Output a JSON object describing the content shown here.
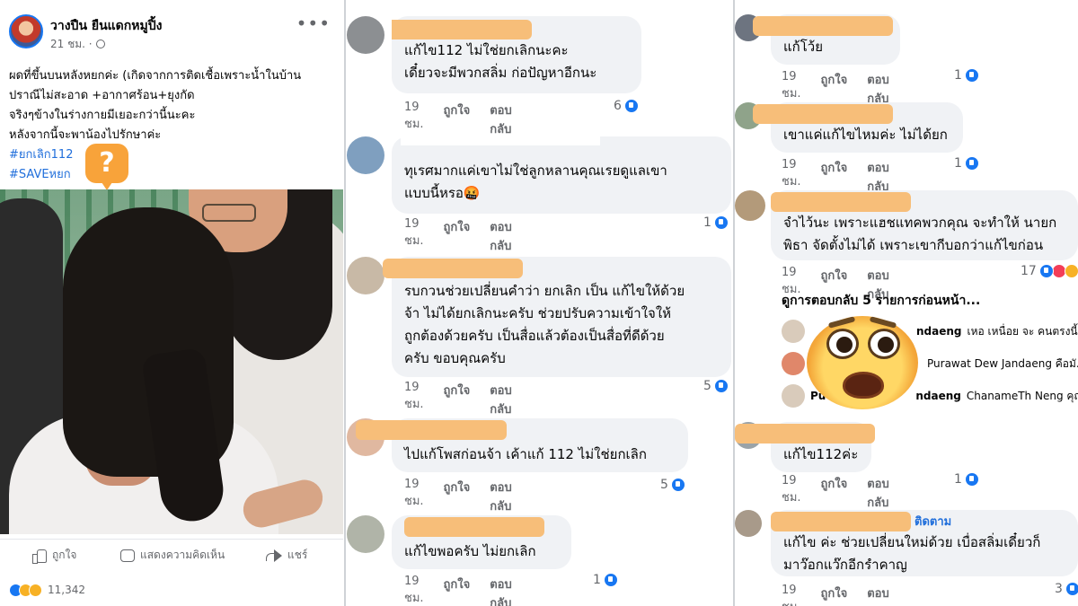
{
  "post": {
    "author": "วางปืน ยืนแดกหมูปิ้ง",
    "time": "21 ชม. ·",
    "text_lines": [
      "ผดที่ขึ้นบนหลังหยกค่ะ (เกิดจากการติดเชื้อเพราะน้ำในบ้าน",
      "ปราณีไม่สะอาด +อากาศร้อน+ยุงกัด",
      "จริงๆข้างในร่างกายมีเยอะกว่านี้นะคะ",
      "หลังจากนี้จะพาน้องไปรักษาค่ะ"
    ],
    "hashtags": [
      "#ยกเลิก112",
      "#SAVEหยก"
    ],
    "overlay_mark": "?",
    "actions": {
      "like": "ถูกใจ",
      "comment": "แสดงความคิดเห็น",
      "share": "แชร์"
    },
    "reaction_count": "11,342"
  },
  "meta_labels": {
    "like": "ถูกใจ",
    "reply": "ตอบกลับ"
  },
  "comments_mid": [
    {
      "text": "แก้ไข112    ไม่ใช่ยกเลิกนะคะ\nเดี๋ยวจะมีพวกสลิ่ม  ก่อปัญหาอีกนะ",
      "time": "19 ชม.",
      "likes": "6"
    },
    {
      "text": "ทุเรศมากแค่เขาไม่ใช่ลูกหลานคุณเรยดูแลเขา\nแบบนี้หรอ🤬",
      "time": "19 ชม.",
      "likes": "1"
    },
    {
      "text": "รบกวนช่วยเปลี่ยนคำว่า ยกเลิก เป็น แก้ไขให้ด้วย\nจ้า ไม่ได้ยกเลิกนะครับ ช่วยปรับความเข้าใจให้\nถูกต้องด้วยครับ เป็นสื่อแล้วต้องเป็นสื่อที่ดีด้วย\nครับ ขอบคุณครับ",
      "time": "19 ชม.",
      "likes": "5"
    },
    {
      "text": "ไปแก้โพสก่อนจ้า เค้าแก้ 112 ไม่ใช่ยกเลิก",
      "time": "19 ชม.",
      "likes": "5"
    },
    {
      "text": "แก้ไขพอครับ ไม่ยกเลิก",
      "time": "19 ชม.",
      "likes": "1"
    }
  ],
  "comments_right": [
    {
      "text": "แก้โว้ย",
      "time": "19 ชม.",
      "likes": "1"
    },
    {
      "text": "เขาแค่แก้ไขไหมค่ะ ไม่ได้ยก",
      "time": "19 ชม.",
      "likes": "1"
    },
    {
      "text": "จำไว้นะ เพราะแฮชแทคพวกคุณ จะทำให้ นายก\nพิธา จัดตั้งไม่ได้ เพราะเขากีบอกว่าแก้ไขก่อน",
      "time": "19 ชม.",
      "likes": "17"
    },
    {
      "text": "แก้ไข112ค่ะ",
      "time": "19 ชม.",
      "likes": "1"
    },
    {
      "text": "แก้ไข ค่ะ ช่วยเปลี่ยนใหม่ด้วย เบื่อสลิ่มเดี๋ยวก็\nมาว๊อกแว๊กอีกรำคาญ",
      "time": "19 ชม.",
      "likes": "3",
      "follow": "ติดตาม"
    }
  ],
  "replies": {
    "link": "ดูการตอบกลับ 5 รายการก่อนหน้า...",
    "rows": [
      {
        "name": "ndaeng",
        "text": "เหอ เหนื่อย จะ คนตรงนี้รู้..."
      },
      {
        "name": "",
        "text": "Purawat Dew Jandaeng คือมั..."
      },
      {
        "name": "Pu",
        "name2": "ndaeng",
        "text": "ChanameTh Neng คุณ..."
      }
    ]
  }
}
